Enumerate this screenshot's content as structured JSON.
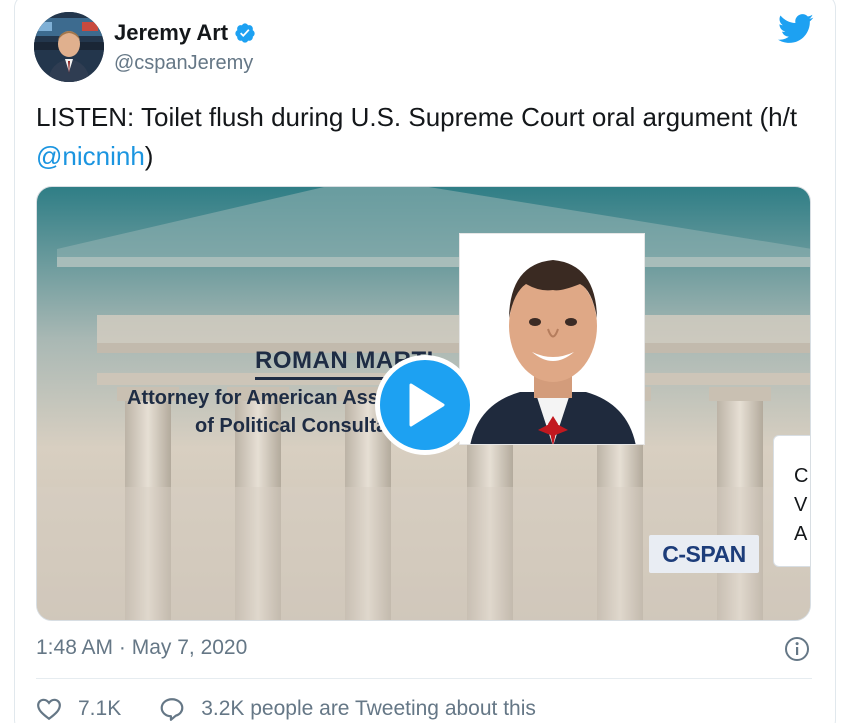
{
  "tweet": {
    "author": {
      "display_name": "Jeremy Art",
      "handle": "@cspanJeremy",
      "verified": true
    },
    "text_prefix": "LISTEN: Toilet flush during U.S. Supreme Court oral argument (h/t ",
    "mention": "@nicninh",
    "text_suffix": ")",
    "media": {
      "name": "ROMAN MARTINEZ",
      "title_line1": "Attorney for American Association",
      "title_line2": "of Political Consultants",
      "logo": "C-SPAN",
      "side_card_lines": [
        "C",
        "V",
        "A"
      ],
      "play_icon": "play-icon"
    },
    "timestamp": "1:48 AM · May 7, 2020",
    "likes": "7.1K",
    "replies_text": "3.2K people are Tweeting about this"
  },
  "colors": {
    "accent": "#1da1f2",
    "link": "#1b95e0",
    "muted": "#657786"
  },
  "icons": [
    "verified-badge-icon",
    "twitter-bird-icon",
    "info-icon",
    "heart-icon",
    "speech-bubble-icon"
  ]
}
